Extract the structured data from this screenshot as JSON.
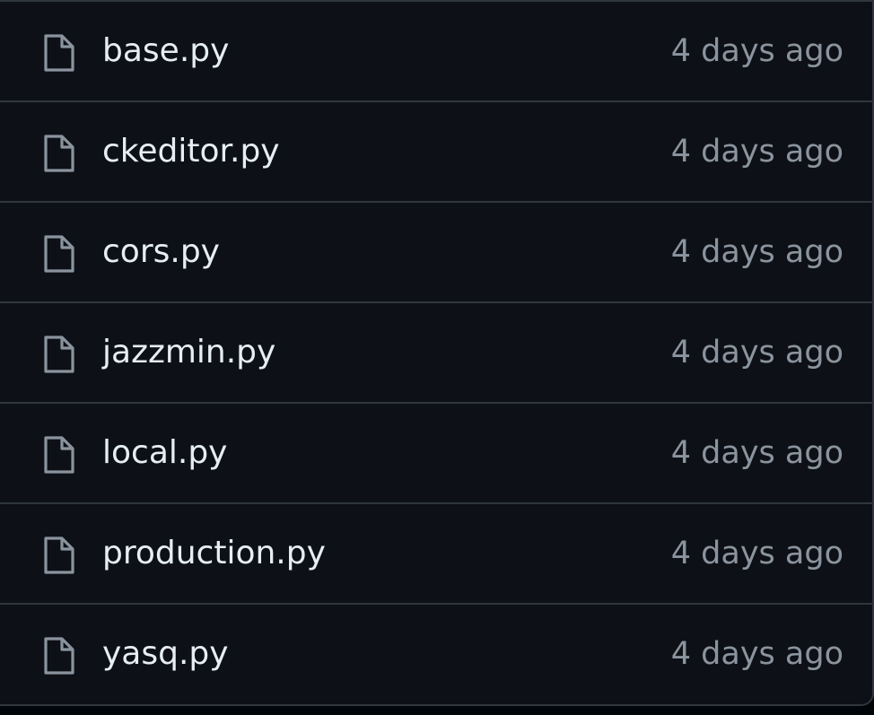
{
  "colors": {
    "background": "#0d1117",
    "outer_background": "#010409",
    "border": "#30363d",
    "file_name": "#e6edf3",
    "muted_text": "#8b949e",
    "icon": "#8b949e"
  },
  "files": [
    {
      "name": "base.py",
      "age": "4 days ago",
      "icon": "file-icon"
    },
    {
      "name": "ckeditor.py",
      "age": "4 days ago",
      "icon": "file-icon"
    },
    {
      "name": "cors.py",
      "age": "4 days ago",
      "icon": "file-icon"
    },
    {
      "name": "jazzmin.py",
      "age": "4 days ago",
      "icon": "file-icon"
    },
    {
      "name": "local.py",
      "age": "4 days ago",
      "icon": "file-icon"
    },
    {
      "name": "production.py",
      "age": "4 days ago",
      "icon": "file-icon"
    },
    {
      "name": "yasq.py",
      "age": "4 days ago",
      "icon": "file-icon"
    }
  ]
}
